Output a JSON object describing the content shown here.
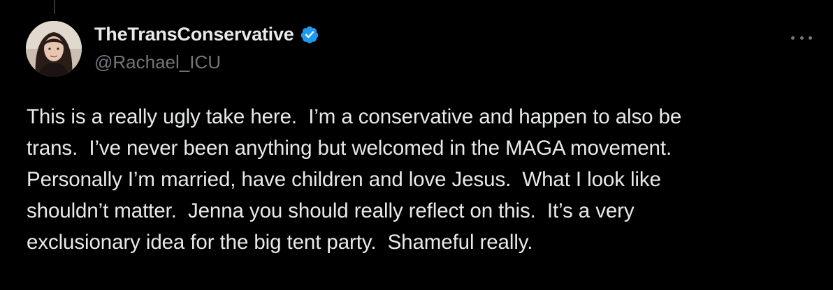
{
  "author": {
    "display_name": "TheTransConservative",
    "handle": "@Rachael_ICU",
    "verified": true,
    "avatar_icon": "profile-photo"
  },
  "more_icon": "ellipsis-icon",
  "tweet": {
    "text": "This is a really ugly take here.  I’m a conservative and happen to also be\ntrans.  I’ve never been anything but welcomed in the MAGA movement.\nPersonally I’m married, have children and love Jesus.  What I look like\nshouldn’t matter.  Jenna you should really reflect on this.  It’s a very\nexclusionary idea for the big tent party.  Shameful really."
  },
  "colors": {
    "background": "#000000",
    "text": "#e7e9ea",
    "secondary_text": "#71767b",
    "verified_badge": "#1d9bf0"
  }
}
